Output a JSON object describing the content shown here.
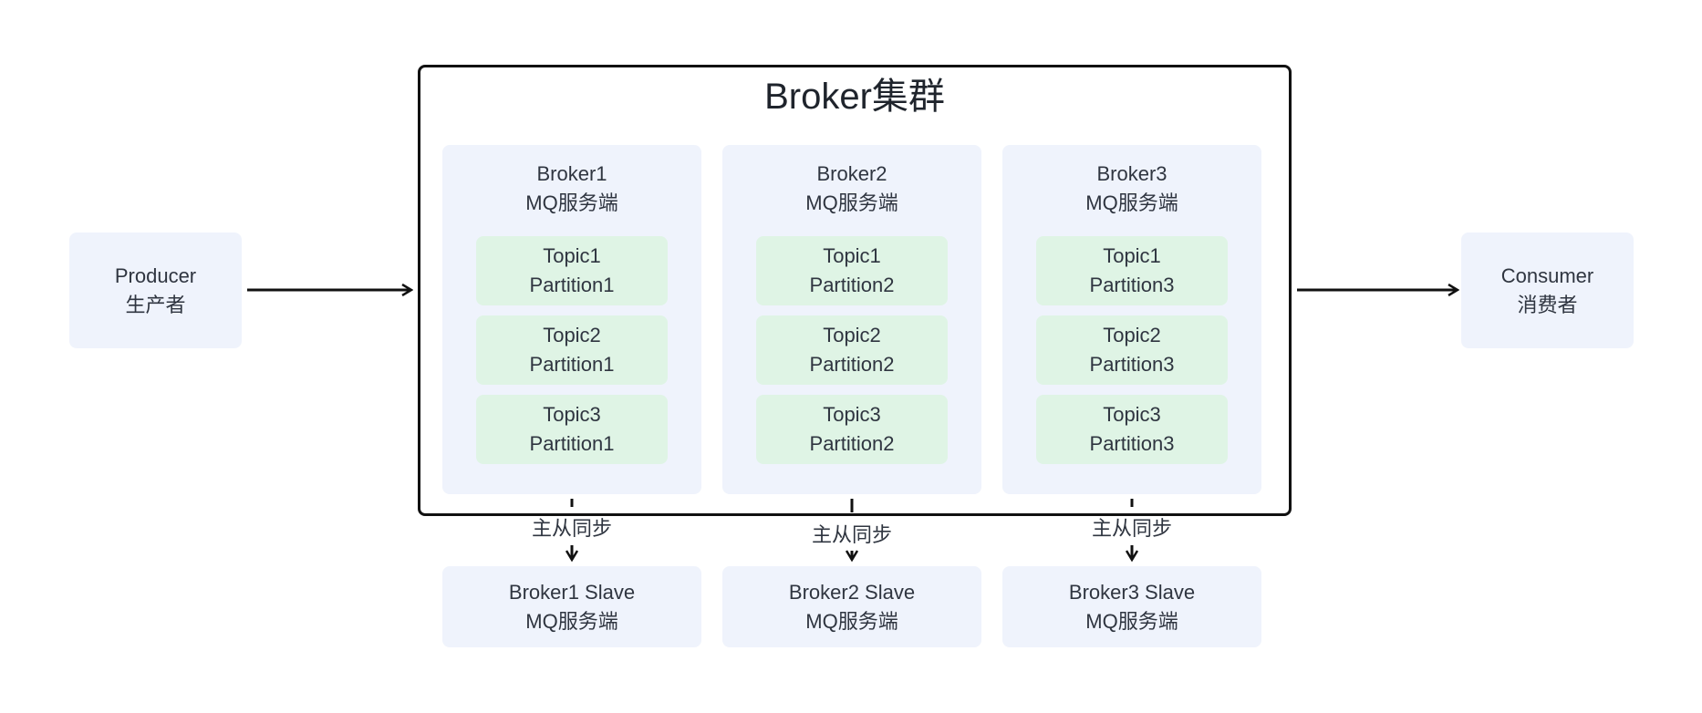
{
  "producer": {
    "name": "Producer",
    "subtitle": "生产者"
  },
  "consumer": {
    "name": "Consumer",
    "subtitle": "消费者"
  },
  "cluster": {
    "title": "Broker集群"
  },
  "brokers": [
    {
      "name": "Broker1",
      "role": "MQ服务端",
      "partitions": [
        {
          "topic": "Topic1",
          "partition": "Partition1"
        },
        {
          "topic": "Topic2",
          "partition": "Partition1"
        },
        {
          "topic": "Topic3",
          "partition": "Partition1"
        }
      ],
      "sync_label": "主从同步",
      "slave": {
        "name": "Broker1 Slave",
        "role": "MQ服务端"
      }
    },
    {
      "name": "Broker2",
      "role": "MQ服务端",
      "partitions": [
        {
          "topic": "Topic1",
          "partition": "Partition2"
        },
        {
          "topic": "Topic2",
          "partition": "Partition2"
        },
        {
          "topic": "Topic3",
          "partition": "Partition2"
        }
      ],
      "sync_label": "主从同步",
      "slave": {
        "name": "Broker2 Slave",
        "role": "MQ服务端"
      }
    },
    {
      "name": "Broker3",
      "role": "MQ服务端",
      "partitions": [
        {
          "topic": "Topic1",
          "partition": "Partition3"
        },
        {
          "topic": "Topic2",
          "partition": "Partition3"
        },
        {
          "topic": "Topic3",
          "partition": "Partition3"
        }
      ],
      "sync_label": "主从同步",
      "slave": {
        "name": "Broker3 Slave",
        "role": "MQ服务端"
      }
    }
  ],
  "colors": {
    "node_fill": "#eff3fc",
    "partition_fill": "#dff4e5",
    "stroke": "#111111",
    "text": "#2f3540"
  }
}
